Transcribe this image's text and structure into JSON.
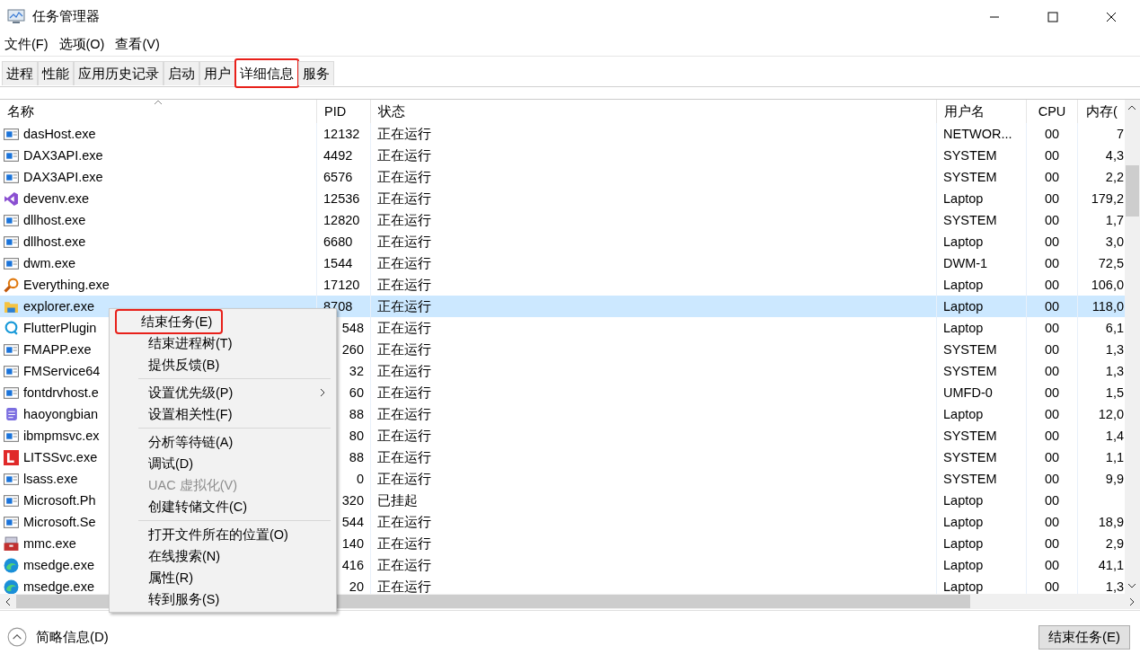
{
  "window": {
    "title": "任务管理器"
  },
  "menu_bar": [
    "文件(F)",
    "选项(O)",
    "查看(V)"
  ],
  "tabs": [
    {
      "label": "进程",
      "selected": false,
      "annotated": false
    },
    {
      "label": "性能",
      "selected": false,
      "annotated": false
    },
    {
      "label": "应用历史记录",
      "selected": false,
      "annotated": false
    },
    {
      "label": "启动",
      "selected": false,
      "annotated": false
    },
    {
      "label": "用户",
      "selected": false,
      "annotated": false
    },
    {
      "label": "详细信息",
      "selected": true,
      "annotated": true
    },
    {
      "label": "服务",
      "selected": false,
      "annotated": false
    }
  ],
  "table": {
    "columns": [
      "名称",
      "PID",
      "状态",
      "用户名",
      "CPU",
      "内存("
    ],
    "rows": [
      {
        "kind": "app",
        "name": "dasHost.exe",
        "pid": "12132",
        "status": "正在运行",
        "user": "NETWOR...",
        "cpu": "00",
        "memory": "7",
        "selected": false
      },
      {
        "kind": "app",
        "name": "DAX3API.exe",
        "pid": "4492",
        "status": "正在运行",
        "user": "SYSTEM",
        "cpu": "00",
        "memory": "4,3",
        "selected": false
      },
      {
        "kind": "app",
        "name": "DAX3API.exe",
        "pid": "6576",
        "status": "正在运行",
        "user": "SYSTEM",
        "cpu": "00",
        "memory": "2,2",
        "selected": false
      },
      {
        "kind": "studio",
        "name": "devenv.exe",
        "pid": "12536",
        "status": "正在运行",
        "user": "Laptop",
        "cpu": "00",
        "memory": "179,2",
        "selected": false
      },
      {
        "kind": "app",
        "name": "dllhost.exe",
        "pid": "12820",
        "status": "正在运行",
        "user": "SYSTEM",
        "cpu": "00",
        "memory": "1,7",
        "selected": false
      },
      {
        "kind": "app",
        "name": "dllhost.exe",
        "pid": "6680",
        "status": "正在运行",
        "user": "Laptop",
        "cpu": "00",
        "memory": "3,0",
        "selected": false
      },
      {
        "kind": "app",
        "name": "dwm.exe",
        "pid": "1544",
        "status": "正在运行",
        "user": "DWM-1",
        "cpu": "00",
        "memory": "72,5",
        "selected": false
      },
      {
        "kind": "magnifier",
        "name": "Everything.exe",
        "pid": "17120",
        "status": "正在运行",
        "user": "Laptop",
        "cpu": "00",
        "memory": "106,0",
        "selected": false
      },
      {
        "kind": "folder",
        "name": "explorer.exe",
        "pid": "8708",
        "status": "正在运行",
        "user": "Laptop",
        "cpu": "00",
        "memory": "118,0",
        "selected": true
      },
      {
        "kind": "bubble",
        "name": "FlutterPlugin",
        "pid": "548",
        "status": "正在运行",
        "user": "Laptop",
        "cpu": "00",
        "memory": "6,1",
        "selected": false
      },
      {
        "kind": "app",
        "name": "FMAPP.exe",
        "pid": "260",
        "status": "正在运行",
        "user": "SYSTEM",
        "cpu": "00",
        "memory": "1,3",
        "selected": false
      },
      {
        "kind": "app",
        "name": "FMService64",
        "pid": "32",
        "status": "正在运行",
        "user": "SYSTEM",
        "cpu": "00",
        "memory": "1,3",
        "selected": false
      },
      {
        "kind": "app",
        "name": "fontdrvhost.e",
        "pid": "60",
        "status": "正在运行",
        "user": "UMFD-0",
        "cpu": "00",
        "memory": "1,5",
        "selected": false
      },
      {
        "kind": "notes",
        "name": "haoyongbian",
        "pid": "88",
        "status": "正在运行",
        "user": "Laptop",
        "cpu": "00",
        "memory": "12,0",
        "selected": false
      },
      {
        "kind": "app",
        "name": "ibmpmsvc.ex",
        "pid": "80",
        "status": "正在运行",
        "user": "SYSTEM",
        "cpu": "00",
        "memory": "1,4",
        "selected": false
      },
      {
        "kind": "letter",
        "name": "LITSSvc.exe",
        "pid": "88",
        "status": "正在运行",
        "user": "SYSTEM",
        "cpu": "00",
        "memory": "1,1",
        "selected": false
      },
      {
        "kind": "app",
        "name": "lsass.exe",
        "pid": "0",
        "status": "正在运行",
        "user": "SYSTEM",
        "cpu": "00",
        "memory": "9,9",
        "selected": false
      },
      {
        "kind": "app",
        "name": "Microsoft.Ph",
        "pid": "320",
        "status": "已挂起",
        "user": "Laptop",
        "cpu": "00",
        "selected": false
      },
      {
        "kind": "app",
        "name": "Microsoft.Se",
        "pid": "544",
        "status": "正在运行",
        "user": "Laptop",
        "cpu": "00",
        "memory": "18,9",
        "selected": false
      },
      {
        "kind": "toolbox",
        "name": "mmc.exe",
        "pid": "140",
        "status": "正在运行",
        "user": "Laptop",
        "cpu": "00",
        "memory": "2,9",
        "selected": false
      },
      {
        "kind": "wave",
        "name": "msedge.exe",
        "pid": "416",
        "status": "正在运行",
        "user": "Laptop",
        "cpu": "00",
        "memory": "41,1",
        "selected": false
      },
      {
        "kind": "wave",
        "name": "msedge.exe",
        "pid": "20",
        "status": "正在运行",
        "user": "Laptop",
        "cpu": "00",
        "memory": "1,3",
        "selected": false
      }
    ]
  },
  "context_menu": {
    "groups": [
      [
        {
          "label": "结束任务(E)",
          "disabled": false,
          "submenu": false,
          "annotated": true
        },
        {
          "label": "结束进程树(T)",
          "disabled": false,
          "submenu": false,
          "annotated": false
        },
        {
          "label": "提供反馈(B)",
          "disabled": false,
          "submenu": false,
          "annotated": false
        }
      ],
      [
        {
          "label": "设置优先级(P)",
          "disabled": false,
          "submenu": true,
          "annotated": false
        },
        {
          "label": "设置相关性(F)",
          "disabled": false,
          "submenu": false,
          "annotated": false
        }
      ],
      [
        {
          "label": "分析等待链(A)",
          "disabled": false,
          "submenu": false,
          "annotated": false
        },
        {
          "label": "调试(D)",
          "disabled": false,
          "submenu": false,
          "annotated": false
        },
        {
          "label": "UAC 虚拟化(V)",
          "disabled": true,
          "submenu": false,
          "annotated": false
        },
        {
          "label": "创建转储文件(C)",
          "disabled": false,
          "submenu": false,
          "annotated": false
        }
      ],
      [
        {
          "label": "打开文件所在的位置(O)",
          "disabled": false,
          "submenu": false,
          "annotated": false
        },
        {
          "label": "在线搜索(N)",
          "disabled": false,
          "submenu": false,
          "annotated": false
        },
        {
          "label": "属性(R)",
          "disabled": false,
          "submenu": false,
          "annotated": false
        },
        {
          "label": "转到服务(S)",
          "disabled": false,
          "submenu": false,
          "annotated": false
        }
      ]
    ]
  },
  "footer": {
    "details_toggle": "简略信息(D)",
    "end_task_button": "结束任务(E)"
  }
}
